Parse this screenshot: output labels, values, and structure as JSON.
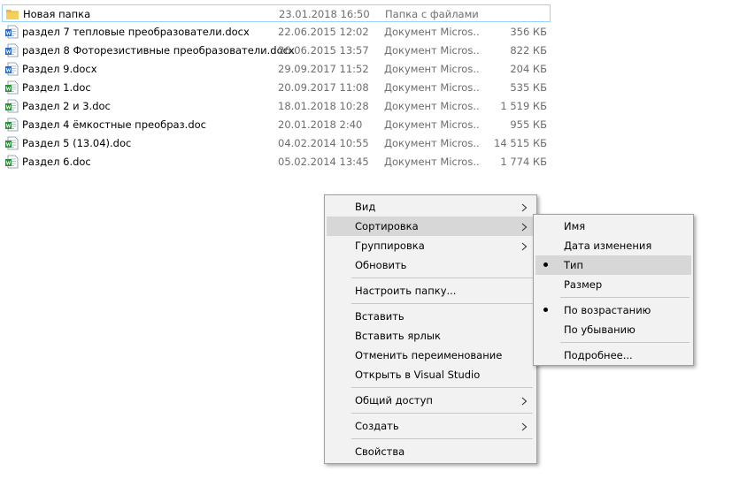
{
  "files": [
    {
      "name": "Новая папка",
      "date": "23.01.2018 16:50",
      "type": "Папка с файлами",
      "size": "",
      "icon": "folder-icon",
      "selected": true
    },
    {
      "name": "раздел 7 тепловые преобразователи.docx",
      "date": "22.06.2015 12:02",
      "type": "Документ Micros...",
      "size": "356 КБ",
      "icon": "word-docx-icon"
    },
    {
      "name": "раздел 8 Фоторезистивные преобразователи.docx",
      "date": "26.06.2015 13:57",
      "type": "Документ Micros...",
      "size": "822 КБ",
      "icon": "word-docx-icon"
    },
    {
      "name": "Раздел 9.docx",
      "date": "29.09.2017 11:52",
      "type": "Документ Micros...",
      "size": "204 КБ",
      "icon": "word-docx-icon"
    },
    {
      "name": "Раздел 1.doc",
      "date": "20.09.2017 11:08",
      "type": "Документ Micros...",
      "size": "535 КБ",
      "icon": "word-doc-icon"
    },
    {
      "name": "Раздел 2 и 3.doc",
      "date": "18.01.2018 10:28",
      "type": "Документ Micros...",
      "size": "1 519 КБ",
      "icon": "word-doc-icon"
    },
    {
      "name": "Раздел 4 ёмкостные преобраз.doc",
      "date": "20.01.2018 2:40",
      "type": "Документ Micros...",
      "size": "955 КБ",
      "icon": "word-doc-icon"
    },
    {
      "name": "Раздел 5 (13.04).doc",
      "date": "04.02.2014 10:55",
      "type": "Документ Micros...",
      "size": "14 515 КБ",
      "icon": "word-doc-icon"
    },
    {
      "name": "Раздел 6.doc",
      "date": "05.02.2014 13:45",
      "type": "Документ Micros...",
      "size": "1 774 КБ",
      "icon": "word-doc-icon"
    }
  ],
  "context_menu": {
    "items": [
      {
        "label": "Вид",
        "submenu": true
      },
      {
        "label": "Сортировка",
        "submenu": true,
        "highlighted": true
      },
      {
        "label": "Группировка",
        "submenu": true
      },
      {
        "label": "Обновить"
      },
      {
        "separator": true
      },
      {
        "label": "Настроить папку..."
      },
      {
        "separator": true
      },
      {
        "label": "Вставить"
      },
      {
        "label": "Вставить ярлык"
      },
      {
        "label": "Отменить переименование"
      },
      {
        "label": "Открыть в Visual Studio"
      },
      {
        "separator": true
      },
      {
        "label": "Общий доступ",
        "submenu": true
      },
      {
        "separator": true
      },
      {
        "label": "Создать",
        "submenu": true
      },
      {
        "separator": true
      },
      {
        "label": "Свойства"
      }
    ]
  },
  "sort_submenu": {
    "items": [
      {
        "label": "Имя"
      },
      {
        "label": "Дата изменения"
      },
      {
        "label": "Тип",
        "checked": true,
        "highlighted": true
      },
      {
        "label": "Размер"
      },
      {
        "separator": true
      },
      {
        "label": "По возрастанию",
        "checked": true
      },
      {
        "label": "По убыванию"
      },
      {
        "separator": true
      },
      {
        "label": "Подробнее..."
      }
    ]
  },
  "colors": {
    "selection_border": "#99d1ff",
    "menu_bg": "#f2f2f2",
    "menu_highlight": "#d7d7d7",
    "secondary_text": "#6d6d6d"
  }
}
